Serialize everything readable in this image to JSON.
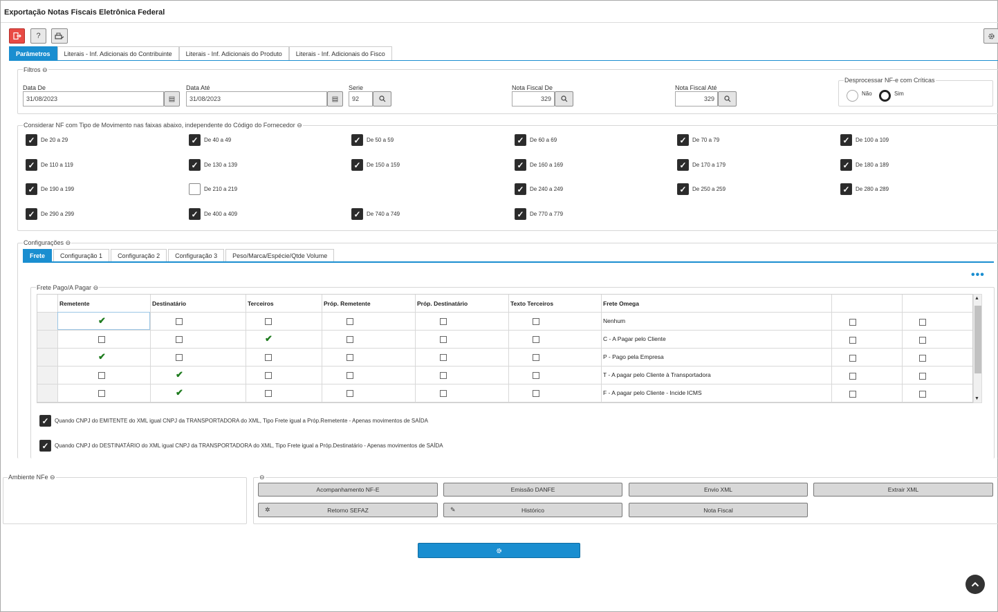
{
  "window": {
    "title": "Exportação Notas Fiscais Eletrônica Federal"
  },
  "toolbar": {
    "exit_icon": "exit-icon",
    "help_label": "?",
    "print_icon": "printer-icon",
    "settings_icon": "gear-icon"
  },
  "tabs": [
    {
      "label": "Parâmetros",
      "active": true
    },
    {
      "label": "Literais - Inf. Adicionais do Contribuinte"
    },
    {
      "label": "Literais - Inf. Adicionais do Produto"
    },
    {
      "label": "Literais - Inf. Adicionais do Fisco"
    }
  ],
  "filtros": {
    "legend": "Filtros",
    "data_de": {
      "label": "Data De",
      "value": "31/08/2023"
    },
    "data_ate": {
      "label": "Data Até",
      "value": "31/08/2023"
    },
    "serie": {
      "label": "Serie",
      "value": "92"
    },
    "nf_de": {
      "label": "Nota Fiscal De",
      "value": "329"
    },
    "nf_ate": {
      "label": "Nota Fiscal Até",
      "value": "329"
    },
    "desprocessar": {
      "legend": "Desprocessar NF-e com Críticas",
      "nao": "Não",
      "sim": "Sim",
      "selected": "Sim"
    }
  },
  "faixas": {
    "legend": "Considerar NF com Tipo de Movimento nas faixas abaixo, independente do Código do Fornecedor",
    "rows": [
      [
        {
          "label": "De 20 a 29",
          "checked": true
        },
        {
          "label": "De 40 a 49",
          "checked": true
        },
        {
          "label": "De 50 a 59",
          "checked": true
        },
        {
          "label": "De 60 a 69",
          "checked": true
        },
        {
          "label": "De 70 a 79",
          "checked": true
        },
        {
          "label": "De 100 a 109",
          "checked": true
        }
      ],
      [
        {
          "label": "De 110 a 119",
          "checked": true
        },
        {
          "label": "De 130 a 139",
          "checked": true
        },
        {
          "label": "De 150 a 159",
          "checked": true
        },
        {
          "label": "De 160 a 169",
          "checked": true
        },
        {
          "label": "De 170 a 179",
          "checked": true
        },
        {
          "label": "De 180 a 189",
          "checked": true
        }
      ],
      [
        {
          "label": "De 190 a 199",
          "checked": true
        },
        {
          "label": "De 210 a 219",
          "checked": false
        },
        null,
        {
          "label": "De 240 a 249",
          "checked": true
        },
        {
          "label": "De 250 a 259",
          "checked": true
        },
        {
          "label": "De 280 a 289",
          "checked": true
        }
      ],
      [
        {
          "label": "De 290 a 299",
          "checked": true
        },
        {
          "label": "De 400 a 409",
          "checked": true
        },
        {
          "label": "De 740 a 749",
          "checked": true
        },
        {
          "label": "De 770 a 779",
          "checked": true
        },
        null,
        null
      ]
    ]
  },
  "config": {
    "legend": "Configurações",
    "tabs": [
      {
        "label": "Frete",
        "active": true
      },
      {
        "label": "Configuração 1"
      },
      {
        "label": "Configuração 2"
      },
      {
        "label": "Configuração 3"
      },
      {
        "label": "Peso/Marca/Espécie/Qtde Volume"
      }
    ],
    "more_icon": "more-icon",
    "frete_legend": "Frete Pago/A Pagar",
    "grid": {
      "headers": [
        "Remetente",
        "Destinatário",
        "Terceiros",
        "Próp. Remetente",
        "Próp. Destinatário",
        "Texto Terceiros",
        "Frete Omega",
        "",
        ""
      ],
      "rows": [
        {
          "checks": [
            true,
            false,
            false,
            false,
            false,
            false
          ],
          "omega": "Nenhum",
          "extra": [
            false,
            false
          ]
        },
        {
          "checks": [
            false,
            false,
            true,
            false,
            false,
            false
          ],
          "omega": "C - A Pagar pelo Cliente",
          "extra": [
            false,
            false
          ]
        },
        {
          "checks": [
            true,
            false,
            false,
            false,
            false,
            false
          ],
          "omega": "P - Pago pela Empresa",
          "extra": [
            false,
            false
          ]
        },
        {
          "checks": [
            false,
            true,
            false,
            false,
            false,
            false
          ],
          "omega": "T - A pagar pelo Cliente à Transportadora",
          "extra": [
            false,
            false
          ]
        },
        {
          "checks": [
            false,
            true,
            false,
            false,
            false,
            false
          ],
          "omega": "F - A pagar pelo Cliente - Incide ICMS",
          "extra": [
            false,
            false
          ]
        }
      ]
    },
    "opt1": "Quando CNPJ do EMITENTE do XML igual CNPJ da TRANSPORTADORA do XML, Tipo Frete igual a Próp.Remetente - Apenas movimentos de SAÍDA",
    "opt2": "Quando CNPJ do DESTINATÁRIO do XML igual CNPJ da TRANSPORTADORA do XML, Tipo Frete igual a Próp.Destinatário - Apenas movimentos de SAÍDA"
  },
  "ambiente": {
    "legend": "Ambiente NFe"
  },
  "actions": {
    "acompanhamento": "Acompanhamento NF-E",
    "emissao": "Emissão DANFE",
    "envio": "Envio XML",
    "extrair": "Extrair XML",
    "retorno": "Retorno SEFAZ",
    "historico": "Histórico",
    "nota": "Nota Fiscal"
  },
  "main_action_icon": "gear-icon",
  "scroll_top_icon": "chevron-up-icon"
}
